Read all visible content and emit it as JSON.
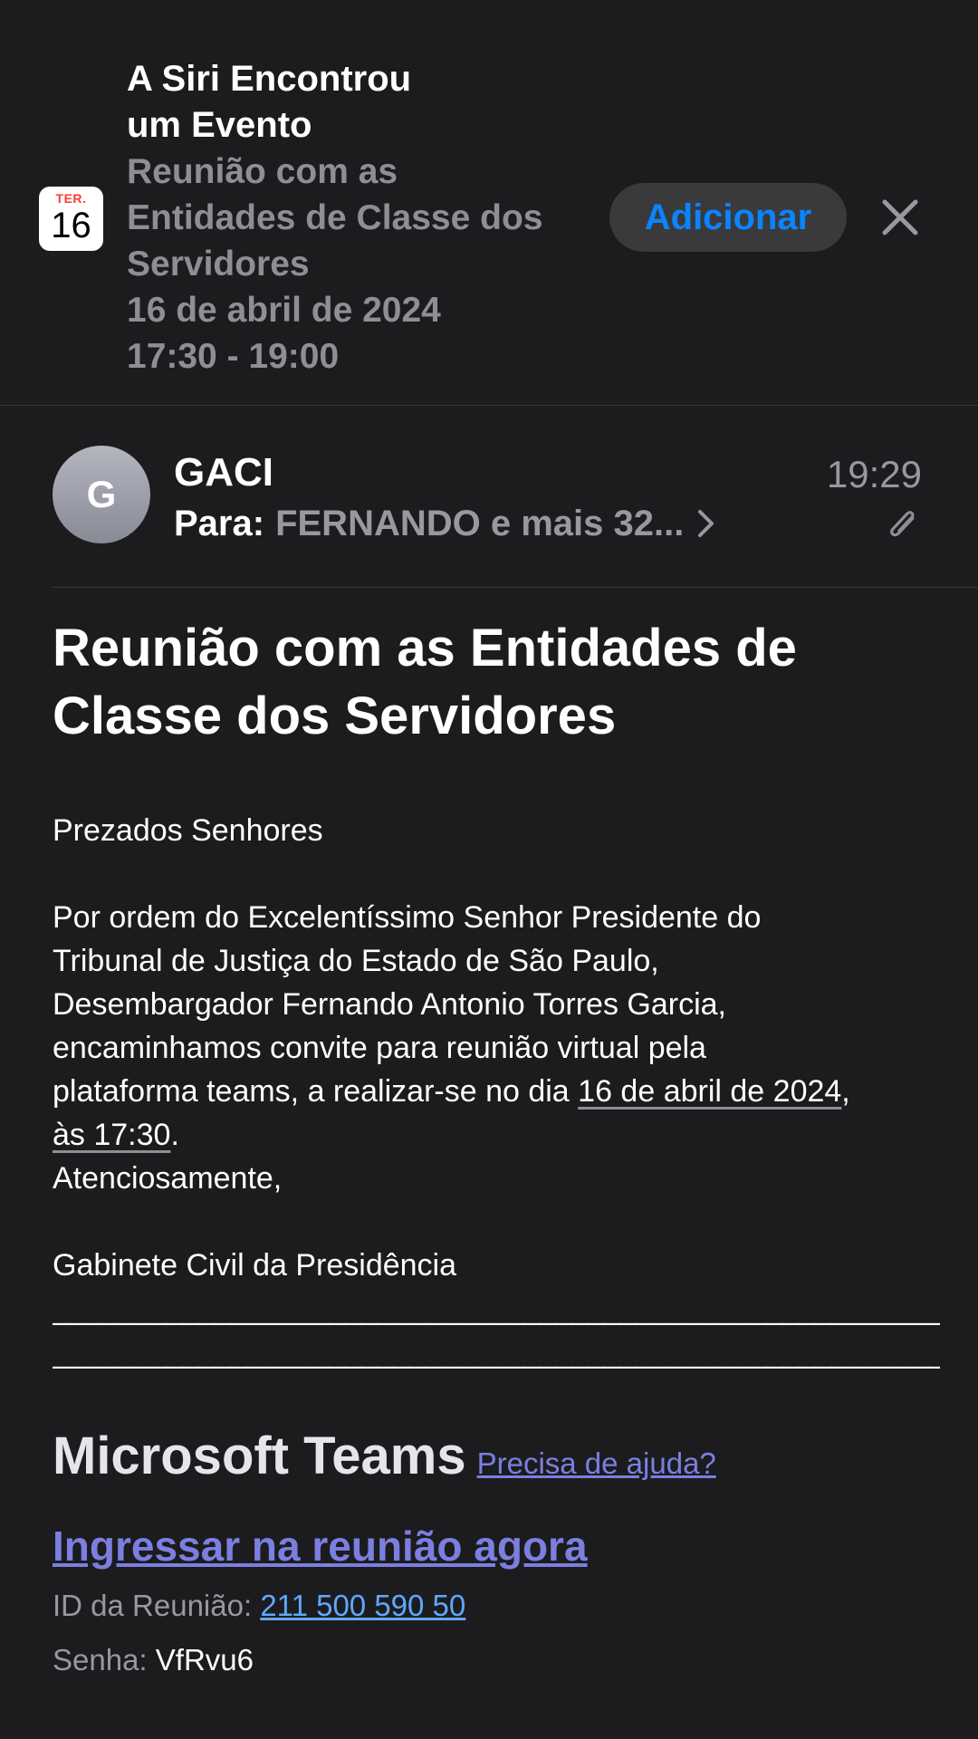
{
  "siri_banner": {
    "title_line1": "A Siri Encontrou",
    "title_line2": "um Evento",
    "event_line1": "Reunião com as",
    "event_line2": "Entidades de Classe dos",
    "event_line3": "Servidores",
    "event_date": "16 de abril de 2024",
    "event_time": "17:30 - 19:00",
    "calendar_weekday": "TER.",
    "calendar_day": "16",
    "add_label": "Adicionar",
    "icons": {
      "close": "close-icon",
      "calendar": "calendar-icon"
    }
  },
  "header": {
    "avatar_initial": "G",
    "sender": "GACI",
    "time": "19:29",
    "to_label": "Para:",
    "to_value": "FERNANDO e mais 32...",
    "icons": {
      "chevron": "chevron-right-icon",
      "attachment": "paperclip-icon"
    }
  },
  "email": {
    "subject_line1": "Reunião com as Entidades de",
    "subject_line2": "Classe dos Servidores",
    "greeting": "Prezados Senhores",
    "para_line1": "Por ordem do Excelentíssimo Senhor Presidente do",
    "para_line2": "Tribunal de Justiça do Estado de São Paulo,",
    "para_line3": "Desembargador Fernando Antonio Torres Garcia,",
    "para_line4": "encaminhamos convite para reunião virtual pela",
    "para_line5_pre": "plataforma teams, a realizar-se no dia ",
    "para_date_link": "16 de abril de 2024",
    "para_line5_post": ",",
    "para_time_link": "às 17:30",
    "para_line6_post": ".",
    "closing": "Atenciosamente,",
    "signature": "Gabinete Civil da Presidência",
    "separator_line1": "________________________________________________________________________________",
    "separator_line2": "________________________________________________________"
  },
  "teams": {
    "title": "Microsoft Teams",
    "help_link": "Precisa de ajuda?",
    "join_link": "Ingressar na reunião agora",
    "meeting_id_label": "ID da Reunião:",
    "meeting_id_value": "211 500 590 50",
    "password_label": "Senha:",
    "password_value": "VfRvu6"
  },
  "colors": {
    "background": "#1c1c1e",
    "accent_blue": "#0a84ff",
    "teams_link": "#7b7fe0",
    "secondary_text": "#98989d"
  }
}
